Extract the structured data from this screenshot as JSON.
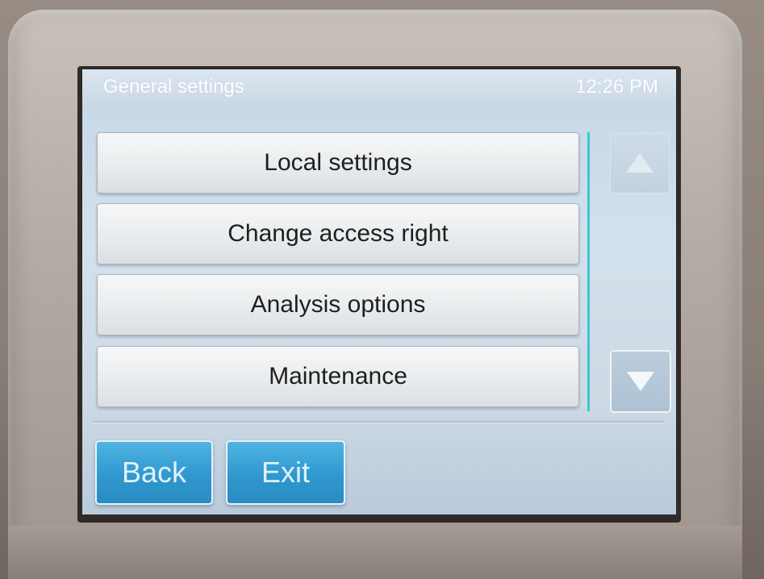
{
  "header": {
    "title": "General settings",
    "clock": "12:26 PM"
  },
  "menu": {
    "items": [
      {
        "label": "Local settings"
      },
      {
        "label": "Change access right"
      },
      {
        "label": "Analysis options"
      },
      {
        "label": "Maintenance"
      }
    ]
  },
  "scroll": {
    "up_icon": "triangle-up-icon",
    "down_icon": "triangle-down-icon"
  },
  "footer": {
    "back_label": "Back",
    "exit_label": "Exit"
  },
  "colors": {
    "accent": "#2f98cf",
    "scrollbar": "#3ec6cf",
    "screen_bg": "#cbd9e4"
  }
}
